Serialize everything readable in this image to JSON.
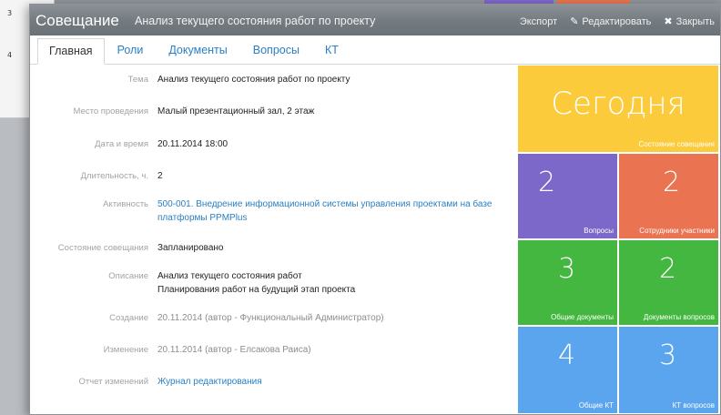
{
  "background": {
    "numbers": [
      "3",
      "4"
    ]
  },
  "titlebar": {
    "title": "Совещание",
    "subtitle": "Анализ текущего состояния работ по проекту",
    "export_label": "Экспорт",
    "edit_label": "Редактировать",
    "close_label": "Закрыть"
  },
  "tabs": [
    {
      "label": "Главная",
      "active": true
    },
    {
      "label": "Роли"
    },
    {
      "label": "Документы"
    },
    {
      "label": "Вопросы"
    },
    {
      "label": "КТ"
    }
  ],
  "fields": {
    "topic": {
      "label": "Тема",
      "value": "Анализ текущего состояния работ по проекту"
    },
    "place": {
      "label": "Место проведения",
      "value": "Малый презентационный зал, 2 этаж"
    },
    "datetime": {
      "label": "Дата и время",
      "value": "20.11.2014 18:00"
    },
    "duration": {
      "label": "Длительность, ч.",
      "value": "2"
    },
    "activity": {
      "label": "Активность",
      "value": "500-001. Внедрение информационной системы управления проектами на базе платформы PPMPlus"
    },
    "state": {
      "label": "Состояние совещания",
      "value": "Запланировано"
    },
    "description": {
      "label": "Описание",
      "line1": "Анализ текущего состояния работ",
      "line2": "Планирования работ на будущий этап проекта"
    },
    "created": {
      "label": "Создание",
      "value": "20.11.2014 (автор - Функциональный Администратор)"
    },
    "modified": {
      "label": "Изменение",
      "value": "20.11.2014 (автор - Елсакова Раиса)"
    },
    "changelog": {
      "label": "Отчет изменений",
      "value": "Журнал редактирования"
    }
  },
  "tiles": {
    "today": {
      "value": "Сегодня",
      "caption": "Состояние совещания",
      "color": "#fbcb3b"
    },
    "questions": {
      "value": "2",
      "caption": "Вопросы",
      "color": "#7b68c8"
    },
    "participants": {
      "value": "2",
      "caption": "Сотрудники участники",
      "color": "#ea7451"
    },
    "common_docs": {
      "value": "3",
      "caption": "Общие документы",
      "color": "#43b73f"
    },
    "question_docs": {
      "value": "2",
      "caption": "Документы вопросов",
      "color": "#43b73f"
    },
    "common_kt": {
      "value": "4",
      "caption": "Общие КТ",
      "color": "#5aa5ee"
    },
    "question_kt": {
      "value": "3",
      "caption": "КТ вопросов",
      "color": "#5aa5ee"
    }
  }
}
